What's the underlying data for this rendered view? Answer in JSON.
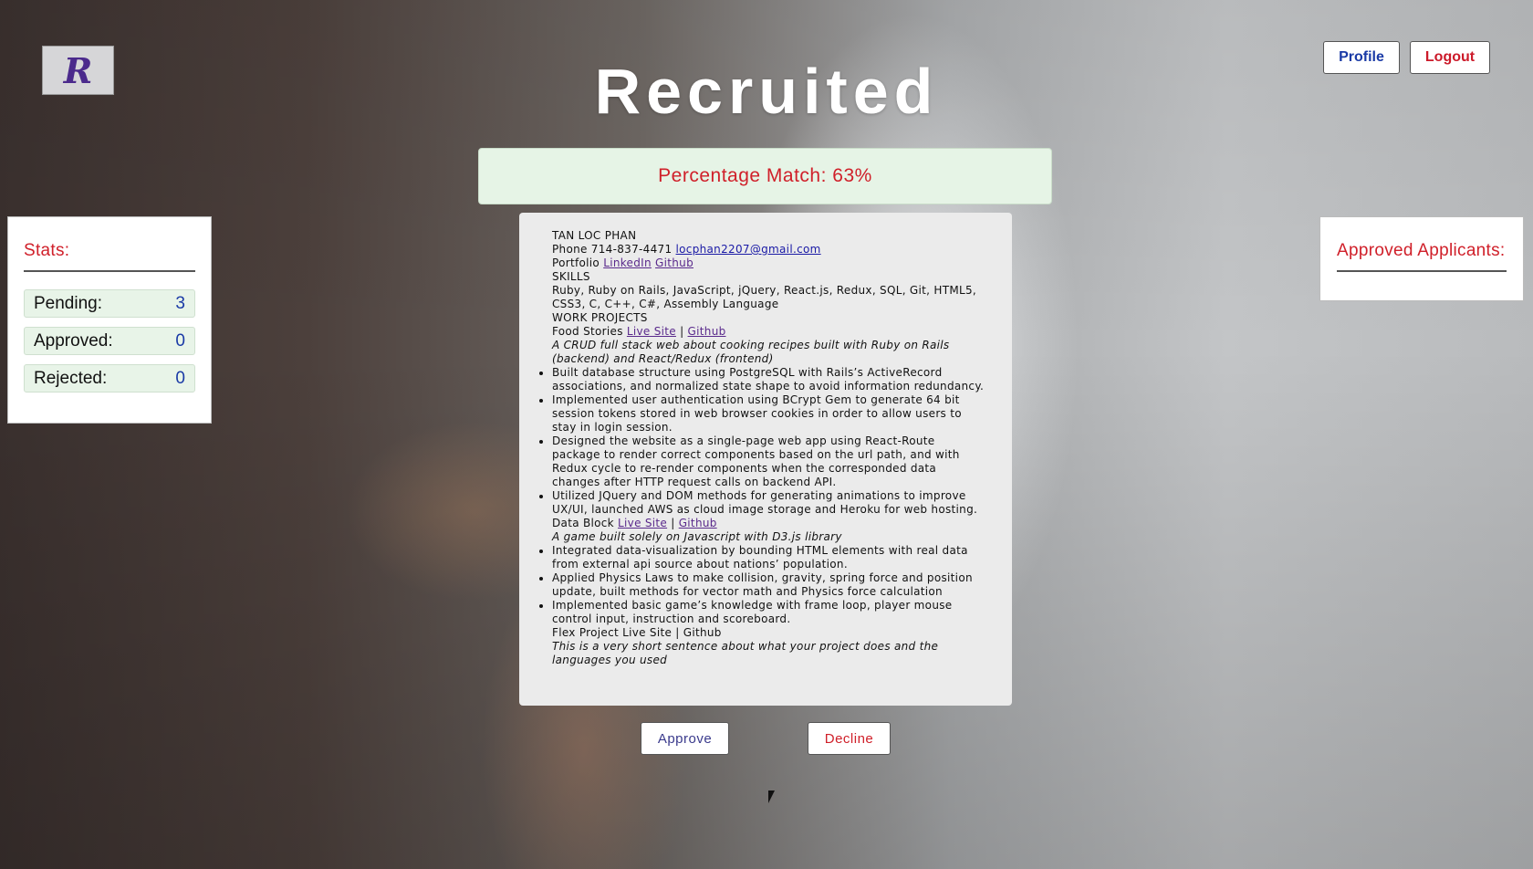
{
  "header": {
    "logo_letter": "R",
    "title": "Recruited",
    "profile_label": "Profile",
    "logout_label": "Logout"
  },
  "match": {
    "text": "Percentage Match: 63%",
    "percent": 63
  },
  "stats": {
    "title": "Stats:",
    "rows": [
      {
        "label": "Pending:",
        "value": "3"
      },
      {
        "label": "Approved:",
        "value": "0"
      },
      {
        "label": "Rejected:",
        "value": "0"
      }
    ]
  },
  "approved_panel": {
    "title": "Approved Applicants:"
  },
  "resume": {
    "name": "TAN LOC PHAN",
    "phone": "Phone 714-837-4471",
    "email": "locphan2207@gmail.com",
    "portfolio_label": "Portfolio",
    "portfolio_links": [
      "LinkedIn",
      "Github"
    ],
    "skills_heading": "SKILLS",
    "skills": "Ruby, Ruby on Rails, JavaScript, jQuery, React.js, Redux, SQL, Git, HTML5, CSS3, C, C++, C#, Assembly Language",
    "work_heading": "WORK PROJECTS",
    "projects": [
      {
        "name": "Food Stories",
        "live": "Live Site",
        "sep": "|",
        "github": "Github",
        "desc": "A CRUD full stack web about cooking recipes built with Ruby on Rails (backend) and React/Redux (frontend)",
        "bullets": [
          "Built database structure using PostgreSQL with Rails’s ActiveRecord associations, and normalized state shape to avoid information redundancy.",
          "Implemented user authentication using BCrypt Gem to generate 64 bit session tokens stored in web browser cookies in order to allow users to stay in login session.",
          "Designed the website as a single-page web app using React-Route package to render correct components based on the url path, and with Redux cycle to re-render components when the corresponded data changes after HTTP request calls on backend API.",
          "Utilized JQuery and DOM methods for generating animations to improve UX/UI, launched AWS as cloud image storage and Heroku for web hosting."
        ]
      },
      {
        "name": "Data Block",
        "live": "Live Site",
        "sep": "|",
        "github": "Github",
        "desc": "A game built solely on Javascript with D3.js library",
        "bullets": [
          "Integrated data-visualization by bounding HTML elements with real data from external api source about nations’ population.",
          "Applied Physics Laws to make collision, gravity, spring force and position update, built methods for vector math and Physics force calculation",
          "Implemented basic game’s knowledge with frame loop, player mouse control input, instruction and scoreboard."
        ]
      }
    ],
    "flex_line": "Flex Project Live Site | Github",
    "flex_desc": "This is a very short sentence about what your project does and the languages you used"
  },
  "actions": {
    "approve_label": "Approve",
    "decline_label": "Decline"
  },
  "colors": {
    "accent_red": "#d0202a",
    "accent_blue": "#1a3aa6",
    "match_bg": "#e6f4e6"
  }
}
